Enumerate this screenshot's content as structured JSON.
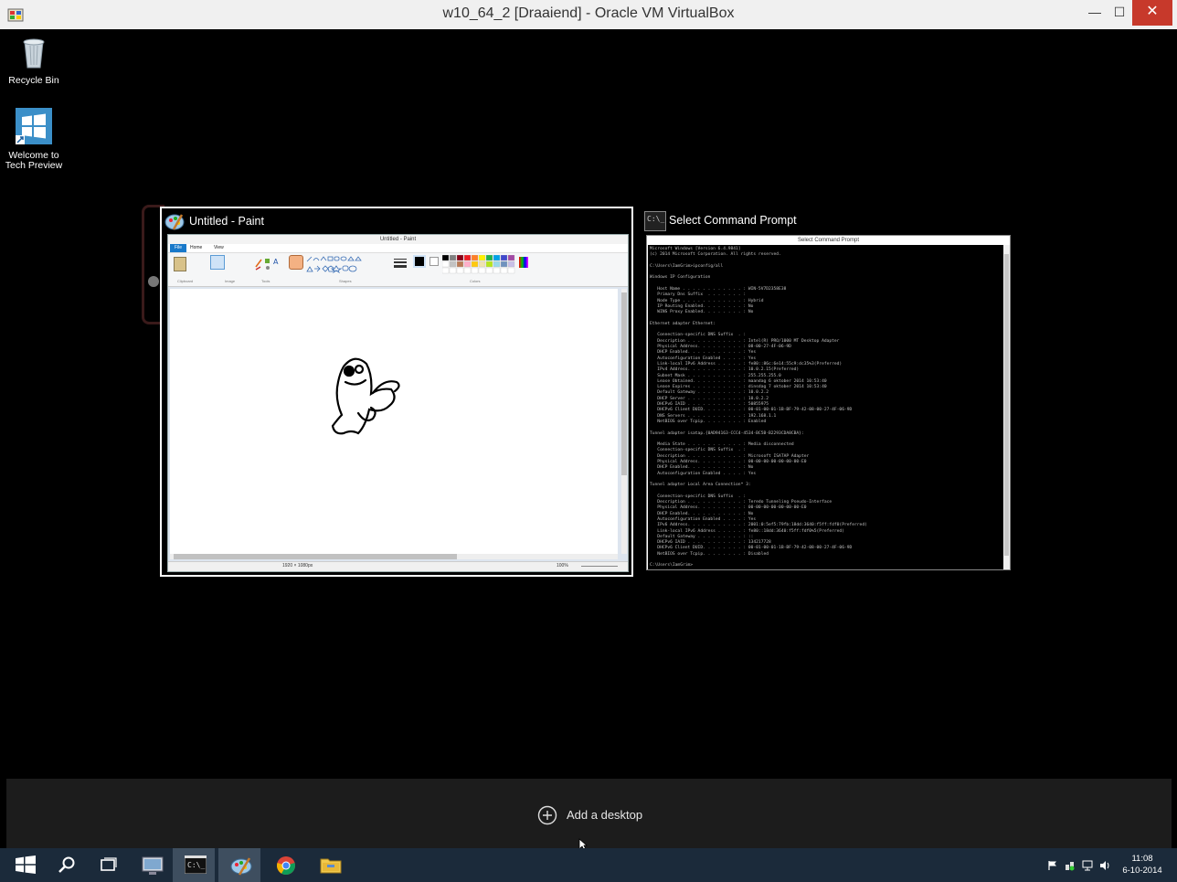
{
  "host_window": {
    "title": "w10_64_2 [Draaiend] - Oracle VM VirtualBox",
    "minimize_glyph": "—",
    "maximize_glyph": "☐",
    "close_glyph": "✕"
  },
  "desktop": {
    "icons": [
      {
        "label": "Recycle Bin",
        "icon": "recycle-bin-icon"
      },
      {
        "label": "Welcome to Tech Preview",
        "icon": "windows-tile-icon"
      }
    ]
  },
  "task_view": {
    "paint": {
      "label": "Untitled - Paint",
      "window_title": "Untitled - Paint",
      "tabs": [
        "File",
        "Home",
        "View"
      ],
      "groups": [
        "Clipboard",
        "Image",
        "Tools",
        "Shapes",
        "Colors"
      ],
      "status_size": "1920 × 1080px",
      "zoom": "100%"
    },
    "cmd": {
      "label": "Select Command Prompt",
      "window_title": "Select Command Prompt",
      "lines": [
        "Microsoft Windows [Version 6.4.9841]",
        "(c) 2014 Microsoft Corporation. All rights reserved.",
        "",
        "C:\\Users\\IamGrim>ipconfig/all",
        "",
        "Windows IP Configuration",
        "",
        "   Host Name . . . . . . . . . . . . : WIN-5V7D2358E38",
        "   Primary Dns Suffix  . . . . . . . :",
        "   Node Type . . . . . . . . . . . . : Hybrid",
        "   IP Routing Enabled. . . . . . . . : No",
        "   WINS Proxy Enabled. . . . . . . . : No",
        "",
        "Ethernet adapter Ethernet:",
        "",
        "   Connection-specific DNS Suffix  . :",
        "   Description . . . . . . . . . . . : Intel(R) PRO/1000 MT Desktop Adapter",
        "   Physical Address. . . . . . . . . : 08-00-27-4F-06-9D",
        "   DHCP Enabled. . . . . . . . . . . : Yes",
        "   Autoconfiguration Enabled . . . . : Yes",
        "   Link-local IPv6 Address . . . . . : fe80::86c:6e14:55c9:dc35%3(Preferred)",
        "   IPv4 Address. . . . . . . . . . . : 10.0.2.15(Preferred)",
        "   Subnet Mask . . . . . . . . . . . : 255.255.255.0",
        "   Lease Obtained. . . . . . . . . . : maandag 6 oktober 2014 10:53:40",
        "   Lease Expires . . . . . . . . . . : dinsdag 7 oktober 2014 10:53:40",
        "   Default Gateway . . . . . . . . . : 10.0.2.2",
        "   DHCP Server . . . . . . . . . . . : 10.0.2.2",
        "   DHCPv6 IAID . . . . . . . . . . . : 50855975",
        "   DHCPv6 Client DUID. . . . . . . . : 00-01-00-01-1B-BF-79-42-08-00-27-4F-06-9D",
        "   DNS Servers . . . . . . . . . . . : 192.168.1.1",
        "   NetBIOS over Tcpip. . . . . . . . : Enabled",
        "",
        "Tunnel adapter isatap.{0AD94163-CCC4-4534-BC5B-B2293CDA8CBA}:",
        "",
        "   Media State . . . . . . . . . . . : Media disconnected",
        "   Connection-specific DNS Suffix  . :",
        "   Description . . . . . . . . . . . : Microsoft ISATAP Adapter",
        "   Physical Address. . . . . . . . . : 00-00-00-00-00-00-00-E0",
        "   DHCP Enabled. . . . . . . . . . . : No",
        "   Autoconfiguration Enabled . . . . : Yes",
        "",
        "Tunnel adapter Local Area Connection* 3:",
        "",
        "   Connection-specific DNS Suffix  . :",
        "   Description . . . . . . . . . . . : Teredo Tunneling Pseudo-Interface",
        "   Physical Address. . . . . . . . . : 00-00-00-00-00-00-00-E0",
        "   DHCP Enabled. . . . . . . . . . . : No",
        "   Autoconfiguration Enabled . . . . : Yes",
        "   IPv6 Address. . . . . . . . . . . : 2001:0:5ef5:79fb:18dd:3640:f5ff:fdf0(Preferred)",
        "   Link-local IPv6 Address . . . . . : fe80::18dd:3640:f5ff:fdf0%5(Preferred)",
        "   Default Gateway . . . . . . . . . : ::",
        "   DHCPv6 IAID . . . . . . . . . . . : 134217728",
        "   DHCPv6 Client DUID. . . . . . . . : 00-01-00-01-1B-BF-79-42-08-00-27-4F-06-9D",
        "   NetBIOS over Tcpip. . . . . . . . : Disabled",
        "",
        "C:\\Users\\IamGrim>"
      ]
    },
    "add_desktop_label": "Add a desktop"
  },
  "taskbar": {
    "buttons": [
      "start-icon",
      "search-icon",
      "task-view-icon",
      "control-panel-icon",
      "cmd-icon",
      "paint-icon",
      "chrome-icon",
      "file-explorer-icon"
    ],
    "active_buttons": [
      "cmd-icon",
      "paint-icon"
    ],
    "tray": [
      "flag-icon",
      "network-status-icon",
      "network-icon",
      "volume-icon"
    ],
    "clock_time": "11:08",
    "clock_date": "6-10-2014"
  },
  "colors": {
    "taskbar_bg": "#1b2a3a",
    "close_button": "#c7392b",
    "paint_ribbon_blue": "#1979ca"
  }
}
